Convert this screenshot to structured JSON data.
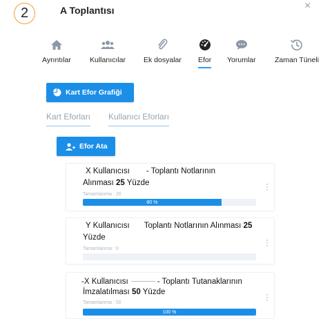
{
  "step_number": "2",
  "meeting_title": "A Toplantısı",
  "close_symbol": "×",
  "tabs": [
    {
      "label": "Ayrıntılar",
      "icon": "home-icon"
    },
    {
      "label": "Kullanıcılar",
      "icon": "users-icon"
    },
    {
      "label": "Ek dosyalar",
      "icon": "paperclip-icon"
    },
    {
      "label": "Efor",
      "icon": "gauge-icon",
      "active": true
    },
    {
      "label": "Yorumlar",
      "icon": "comment-icon"
    },
    {
      "label": "Zaman Tüneli",
      "icon": "history-icon"
    }
  ],
  "chart_button_label": "Kart Efor Grafiği",
  "subtabs": [
    {
      "label": "Kart Eforları"
    },
    {
      "label": "Kullanıcı Eforları"
    }
  ],
  "assign_button_label": "Efor Ata",
  "efforts": [
    {
      "user": "X Kullanıcısı",
      "text_a": "- Toplantı Notlarının",
      "text_b": "Alınması",
      "value": "25",
      "text_c": "Yüzde",
      "completion_label": "Tamamlanma : 20",
      "progress_percent": 80,
      "progress_label": "80 %"
    },
    {
      "user": "Y Kullanıcısı",
      "text_a": "Toplantı Notlarının Alınması",
      "value": "25",
      "text_c": "Yüzde",
      "completion_label": "Tamamlanma : 0",
      "progress_percent": 0,
      "progress_label": ""
    },
    {
      "user": "-X Kullanıcısı",
      "text_a": "- Toplantı Tutanaklarının",
      "text_b": "İmzalatılması",
      "value": "50",
      "text_c": "Yüzde",
      "completion_label": "Tamamlanma : 50",
      "progress_percent": 100,
      "progress_label": "100 %"
    }
  ],
  "colors": {
    "accent": "#1b8fe8",
    "badge_border": "#f0a030",
    "tab_underline": "#2da0f0"
  }
}
